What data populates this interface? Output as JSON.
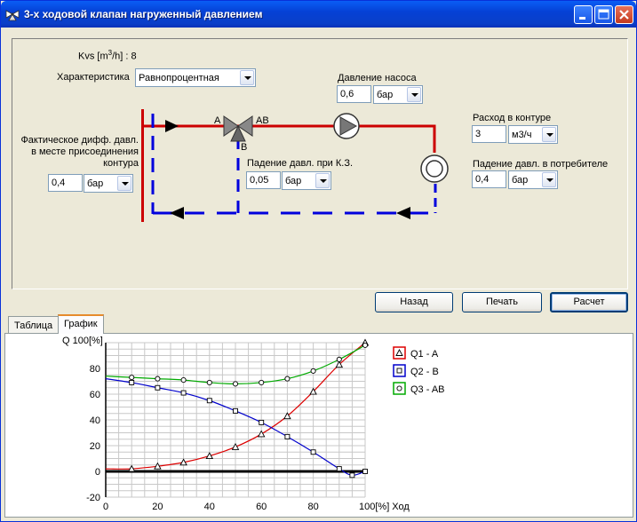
{
  "window": {
    "title": "3-х ходовой клапан нагруженный давлением",
    "icons": [
      "valve-app-icon",
      "minimize-icon",
      "maximize-icon",
      "close-icon"
    ]
  },
  "params": {
    "kvs_prefix": "Kvs [m",
    "kvs_sup": "3",
    "kvs_suffix": "/h] : 8",
    "characteristic_label": "Характеристика",
    "characteristic_value": "Равнопроцентная",
    "pump_pressure_label": "Давление насоса",
    "pump_pressure_value": "0,6",
    "pump_pressure_unit": "бар",
    "flow_label": "Расход в контуре",
    "flow_value": "3",
    "flow_unit": "м3/ч",
    "consumer_drop_label": "Падение давл. в потребителе",
    "consumer_drop_value": "0,4",
    "consumer_drop_unit": "бар",
    "kz_drop_label": "Падение давл. при К.З.",
    "kz_drop_value": "0,05",
    "kz_drop_unit": "бар",
    "diff_label_line1": "Фактическое дифф. давл.",
    "diff_label_line2": "в месте присоединения",
    "diff_label_line3": "контура",
    "diff_value": "0,4",
    "diff_unit": "бар"
  },
  "diagram": {
    "port_a": "A",
    "port_ab": "AB",
    "port_b": "B",
    "supply_color": "#cc0000",
    "return_color": "#0000dd"
  },
  "buttons": {
    "back": "Назад",
    "print": "Печать",
    "calculate": "Расчет"
  },
  "tabs": {
    "table": "Таблица",
    "graph": "График",
    "active": "График"
  },
  "chart_data": {
    "type": "line",
    "ylabel": "Q 100[%]",
    "xlabel": "100[%] Ход",
    "xlim": [
      0,
      100
    ],
    "ylim": [
      -20,
      100
    ],
    "x_ticks": [
      "0",
      "20",
      "40",
      "60",
      "80"
    ],
    "y_ticks": [
      "-20",
      "0",
      "20",
      "40",
      "60",
      "80"
    ],
    "grid": true,
    "legend_position": "right",
    "series": [
      {
        "name": "Q1 - A",
        "color": "#dd0000",
        "marker": "triangle",
        "x": [
          0,
          10,
          20,
          30,
          40,
          50,
          60,
          70,
          80,
          90,
          100
        ],
        "y": [
          2,
          2,
          4,
          7,
          12,
          19,
          29,
          43,
          62,
          83,
          100
        ]
      },
      {
        "name": "Q2 - B",
        "color": "#0000cc",
        "marker": "square",
        "x": [
          0,
          10,
          20,
          30,
          40,
          50,
          60,
          70,
          80,
          90,
          95,
          100
        ],
        "y": [
          72,
          69,
          65,
          61,
          55,
          47,
          38,
          27,
          15,
          2,
          -3,
          0
        ]
      },
      {
        "name": "Q3 - AB",
        "color": "#00aa00",
        "marker": "circle",
        "x": [
          0,
          10,
          20,
          30,
          40,
          50,
          60,
          70,
          80,
          90,
          100
        ],
        "y": [
          74,
          73,
          72,
          71,
          69,
          68,
          69,
          72,
          78,
          87,
          98
        ]
      }
    ]
  }
}
